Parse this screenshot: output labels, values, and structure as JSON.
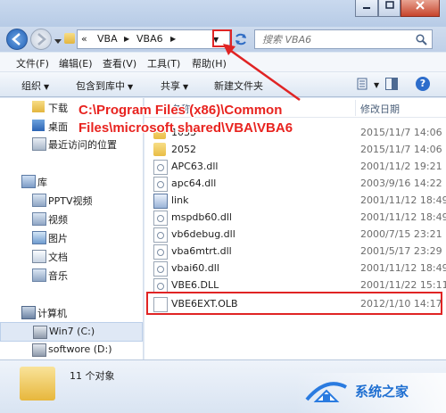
{
  "address": {
    "crumbs": [
      "«",
      "VBA",
      "VBA6"
    ],
    "search_placeholder": "搜索 VBA6"
  },
  "menu": [
    "文件(F)",
    "编辑(E)",
    "查看(V)",
    "工具(T)",
    "帮助(H)"
  ],
  "toolbar": {
    "organize": "组织",
    "include": "包含到库中",
    "share": "共享",
    "new_folder": "新建文件夹"
  },
  "columns": {
    "name": "名称",
    "modified": "修改日期"
  },
  "nav": {
    "downloads": "下载",
    "desktop": "桌面",
    "recent": "最近访问的位置",
    "libraries": "库",
    "pptv": "PPTV视频",
    "videos": "视频",
    "pictures": "图片",
    "documents": "文档",
    "music": "音乐",
    "computer": "计算机",
    "drive_c": "Win7 (C:)",
    "drive_d": "softwore (D:)"
  },
  "files": [
    {
      "name": "1033",
      "date": "2015/11/7 14:06",
      "icon": "folder-icon"
    },
    {
      "name": "2052",
      "date": "2015/11/7 14:06",
      "icon": "folder-icon"
    },
    {
      "name": "APC63.dll",
      "date": "2001/11/2 19:21",
      "icon": "dll-icon"
    },
    {
      "name": "apc64.dll",
      "date": "2003/9/16 14:22",
      "icon": "dll-icon"
    },
    {
      "name": "link",
      "date": "2001/11/12 18:49",
      "icon": "link-icon"
    },
    {
      "name": "mspdb60.dll",
      "date": "2001/11/12 18:49",
      "icon": "dll-icon"
    },
    {
      "name": "vb6debug.dll",
      "date": "2000/7/15 23:21",
      "icon": "dll-icon"
    },
    {
      "name": "vba6mtrt.dll",
      "date": "2001/5/17 23:29",
      "icon": "dll-icon"
    },
    {
      "name": "vbai60.dll",
      "date": "2001/11/12 18:49",
      "icon": "dll-icon"
    },
    {
      "name": "VBE6.DLL",
      "date": "2001/11/22 15:11",
      "icon": "dll-icon"
    },
    {
      "name": "VBE6EXT.OLB",
      "date": "2012/1/10 14:17",
      "icon": "document-icon"
    }
  ],
  "annotation": {
    "line1": "C:\\Program Files (x86)\\Common",
    "line2": "Files\\microsoft shared\\VBA\\VBA6"
  },
  "status": {
    "count": "11 个对象"
  },
  "watermark": {
    "text": "系统之家"
  },
  "colors": {
    "highlight": "#e02424",
    "annotation": "#e8231f"
  }
}
